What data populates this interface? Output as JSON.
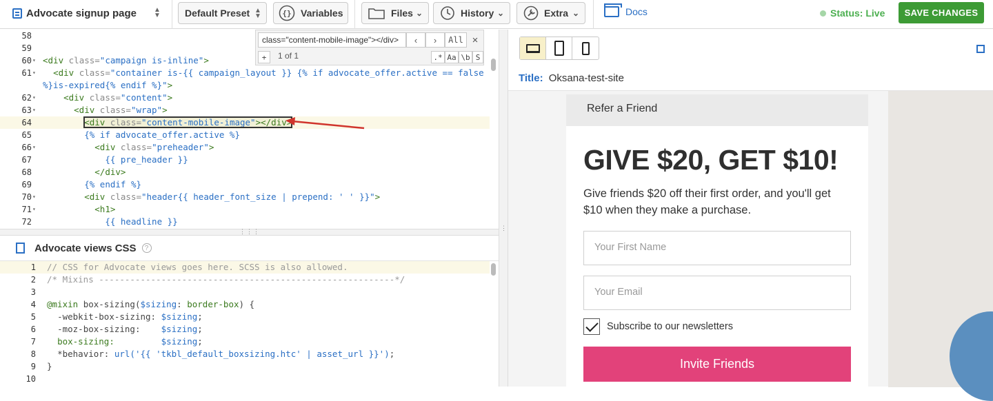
{
  "topbar": {
    "page_name": "Advocate signup page",
    "preset": "Default Preset",
    "variables": "Variables",
    "files": "Files",
    "history": "History",
    "extra": "Extra",
    "docs": "Docs",
    "status": "Status: Live",
    "save": "SAVE CHANGES"
  },
  "search": {
    "query": "class=\"content-mobile-image\"></div>",
    "count": "1 of 1",
    "all": "All",
    "plus": "+",
    "regex": ".*",
    "case": "Aa",
    "word": "\\b",
    "sel": "S"
  },
  "editor": {
    "lines": [
      {
        "n": "58",
        "fold": false,
        "html": ""
      },
      {
        "n": "59",
        "fold": false,
        "html": ""
      },
      {
        "n": "60",
        "fold": true,
        "html": "<span class='tag'>&lt;div</span> <span class='attr'>class=</span><span class='str'>\"campaign is-inline\"</span><span class='tag'>&gt;</span>"
      },
      {
        "n": "61",
        "fold": true,
        "html": "  <span class='tag'>&lt;div</span> <span class='attr'>class=</span><span class='str'>\"container is-{{ campaign_layout }} {% if advocate_offer.active == false</span>"
      },
      {
        "n": "",
        "fold": false,
        "html": "<span class='str'>%}is-expired{% endif %}\"</span><span class='tag'>&gt;</span>"
      },
      {
        "n": "62",
        "fold": true,
        "html": "    <span class='tag'>&lt;div</span> <span class='attr'>class=</span><span class='str'>\"content\"</span><span class='tag'>&gt;</span>"
      },
      {
        "n": "63",
        "fold": true,
        "html": "      <span class='tag'>&lt;div</span> <span class='attr'>class=</span><span class='str'>\"wrap\"</span><span class='tag'>&gt;</span>"
      },
      {
        "n": "64",
        "fold": false,
        "hl": true,
        "html": "        <span class='sel'><span class='tag'>&lt;div</span> <span class='attr'>class=</span><span class='str'>\"content-mobile-image\"</span><span class='tag'>&gt;&lt;/div&gt;</span></span>"
      },
      {
        "n": "65",
        "fold": false,
        "html": "        <span class='liq'>{% if advocate_offer.active %}</span>"
      },
      {
        "n": "66",
        "fold": true,
        "html": "          <span class='tag'>&lt;div</span> <span class='attr'>class=</span><span class='str'>\"preheader\"</span><span class='tag'>&gt;</span>"
      },
      {
        "n": "67",
        "fold": false,
        "html": "            <span class='liq'>{{ pre_header }}</span>"
      },
      {
        "n": "68",
        "fold": false,
        "html": "          <span class='tag'>&lt;/div&gt;</span>"
      },
      {
        "n": "69",
        "fold": false,
        "html": "        <span class='liq'>{% endif %}</span>"
      },
      {
        "n": "70",
        "fold": true,
        "html": "        <span class='tag'>&lt;div</span> <span class='attr'>class=</span><span class='str'>\"header{{ header_font_size | prepend: ' ' }}\"</span><span class='tag'>&gt;</span>"
      },
      {
        "n": "71",
        "fold": true,
        "html": "          <span class='tag'>&lt;h1&gt;</span>"
      },
      {
        "n": "72",
        "fold": false,
        "html": "            <span class='liq'>{{ headline }}</span>"
      }
    ]
  },
  "css_panel": {
    "title": "Advocate views CSS",
    "help": "?",
    "lines": [
      {
        "n": "1",
        "fold": false,
        "hl": true,
        "html": "<span class='cm'>// CSS for Advocate views goes here. SCSS is also allowed.</span>"
      },
      {
        "n": "2",
        "fold": false,
        "html": "<span class='cm'>/* Mixins ---------------------------------------------------------*/</span>"
      },
      {
        "n": "3",
        "fold": false,
        "html": ""
      },
      {
        "n": "4",
        "fold": true,
        "html": "<span class='at'>@mixin</span> <span class='prop'>box-sizing(</span><span class='val'>$sizing</span><span class='prop'>:</span> <span class='at'>border-box</span><span class='prop'>) {</span>"
      },
      {
        "n": "5",
        "fold": false,
        "html": "  <span class='prop'>-webkit-box-sizing:</span> <span class='val'>$sizing</span><span class='prop'>;</span>"
      },
      {
        "n": "6",
        "fold": false,
        "html": "  <span class='prop'>-moz-box-sizing:</span>    <span class='val'>$sizing</span><span class='prop'>;</span>"
      },
      {
        "n": "7",
        "fold": false,
        "html": "  <span class='at'>box-sizing:</span>         <span class='val'>$sizing</span><span class='prop'>;</span>"
      },
      {
        "n": "8",
        "fold": false,
        "html": "  <span class='prop'>*behavior:</span> <span class='val'>url('{{ 'tkbl_default_boxsizing.htc' | asset_url }}')</span><span class='prop'>;</span>"
      },
      {
        "n": "9",
        "fold": false,
        "html": "<span class='prop'>}</span>"
      },
      {
        "n": "10",
        "fold": false,
        "html": ""
      }
    ]
  },
  "preview": {
    "title_label": "Title:",
    "title_value": "Oksana-test-site",
    "card_header": "Refer a Friend",
    "headline": "GIVE $20, GET $10!",
    "subtext": "Give friends $20 off their first order, and you'll get $10 when they make a purchase.",
    "first_name_placeholder": "Your First Name",
    "email_placeholder": "Your Email",
    "newsletter": "Subscribe to our newsletters",
    "invite": "Invite Friends"
  },
  "colors": {
    "accent": "#2a6fc4",
    "save": "#3d9b35",
    "invite": "#e2427a",
    "status": "#4caf50"
  },
  "icons": [
    "page-icon",
    "updown-icon",
    "braces-icon",
    "folder-icon",
    "history-icon",
    "wrench-icon",
    "docs-box-icon",
    "laptop-icon",
    "tablet-icon",
    "phone-icon",
    "external-link-icon",
    "file-icon",
    "help-icon",
    "checkmark-icon",
    "annotation-arrow"
  ]
}
